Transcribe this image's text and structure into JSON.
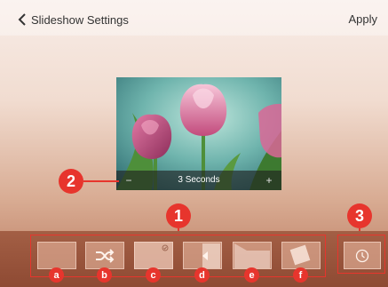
{
  "header": {
    "back_label": "Slideshow Settings",
    "apply_label": "Apply"
  },
  "preview": {
    "duration_label": "3 Seconds",
    "minus_label": "−",
    "plus_label": "+"
  },
  "callouts": {
    "effects": "1",
    "duration": "2",
    "timer": "3"
  },
  "effects": [
    {
      "letter": "a",
      "icon": "none-transition-icon"
    },
    {
      "letter": "b",
      "icon": "shuffle-icon"
    },
    {
      "letter": "c",
      "icon": "fade-icon"
    },
    {
      "letter": "d",
      "icon": "slide-icon"
    },
    {
      "letter": "e",
      "icon": "fold-icon"
    },
    {
      "letter": "f",
      "icon": "rotate-icon"
    }
  ],
  "colors": {
    "callout": "#e7352d",
    "bar": "#98543b"
  }
}
